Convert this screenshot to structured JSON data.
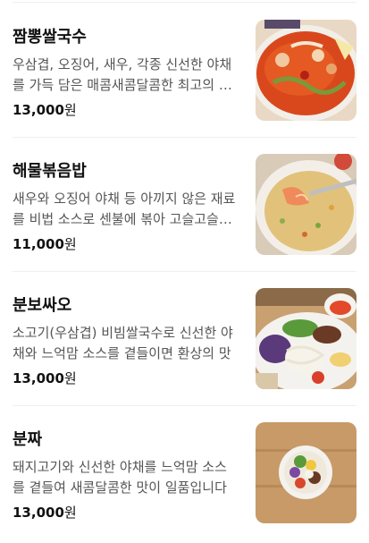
{
  "menu": {
    "items": [
      {
        "name": "짬뽕쌀국수",
        "description": "우삼겹, 오징어, 새우, 각종 신선한 야채를 가득 담은 매콤새콤달콤한 최고의 쌀국수",
        "price": "13,000",
        "currency": "원",
        "image": "jjamppong-noodle-photo"
      },
      {
        "name": "해물볶음밥",
        "description": "새우와 오징어 야채 등 아끼지 않은 재료를 비법 소스로 센불에 볶아 고슬고슬한 볶음밥",
        "price": "11,000",
        "currency": "원",
        "image": "seafood-fried-rice-photo"
      },
      {
        "name": "분보싸오",
        "description": "소고기(우삼겹) 비빔쌀국수로 신선한 야채와 느억맘 소스를 곁들이면 환상의 맛",
        "price": "13,000",
        "currency": "원",
        "image": "bun-bo-xao-photo"
      },
      {
        "name": "분짜",
        "description": "돼지고기와 신선한 야채를 느억맘 소스를 곁들여 새콤달콤한 맛이 일품입니다",
        "price": "13,000",
        "currency": "원",
        "image": "bun-cha-photo"
      }
    ]
  }
}
